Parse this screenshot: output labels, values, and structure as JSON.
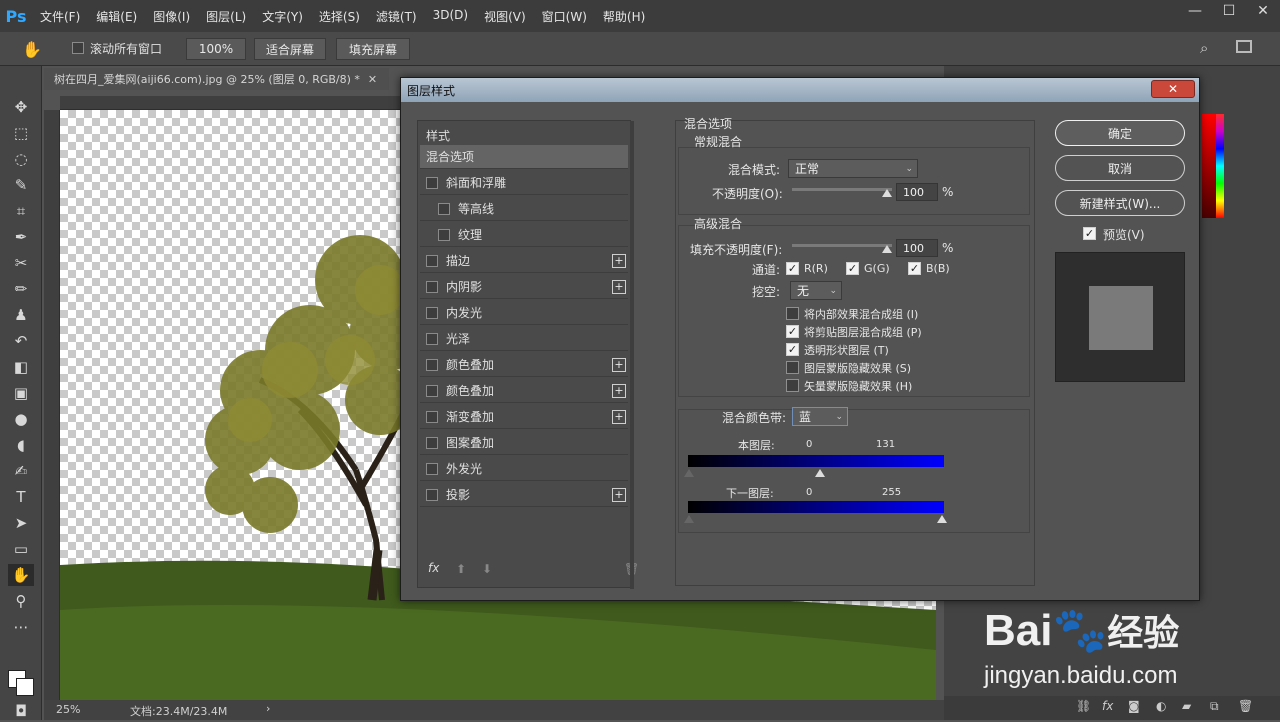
{
  "menubar": {
    "logo": "Ps",
    "items": [
      "文件(F)",
      "编辑(E)",
      "图像(I)",
      "图层(L)",
      "文字(Y)",
      "选择(S)",
      "滤镜(T)",
      "3D(D)",
      "视图(V)",
      "窗口(W)",
      "帮助(H)"
    ]
  },
  "options": {
    "scroll_all_label": "滚动所有窗口",
    "zoom": "100%",
    "fit_screen": "适合屏幕",
    "fill_screen": "填充屏幕"
  },
  "document": {
    "tab_title": "树在四月_爱集网(aiji66.com).jpg @ 25% (图层 0, RGB/8) *",
    "zoom_status": "25%",
    "doc_size": "文档:23.4M/23.4M"
  },
  "dialog": {
    "title": "图层样式",
    "style_list_header": "样式",
    "styles": [
      {
        "label": "混合选项",
        "checkbox": false,
        "plus": false,
        "selected": true,
        "indent": false
      },
      {
        "label": "斜面和浮雕",
        "checkbox": true,
        "plus": false,
        "selected": false,
        "indent": false
      },
      {
        "label": "等高线",
        "checkbox": true,
        "plus": false,
        "selected": false,
        "indent": true
      },
      {
        "label": "纹理",
        "checkbox": true,
        "plus": false,
        "selected": false,
        "indent": true
      },
      {
        "label": "描边",
        "checkbox": true,
        "plus": true,
        "selected": false,
        "indent": false
      },
      {
        "label": "内阴影",
        "checkbox": true,
        "plus": true,
        "selected": false,
        "indent": false
      },
      {
        "label": "内发光",
        "checkbox": true,
        "plus": false,
        "selected": false,
        "indent": false
      },
      {
        "label": "光泽",
        "checkbox": true,
        "plus": false,
        "selected": false,
        "indent": false
      },
      {
        "label": "颜色叠加",
        "checkbox": true,
        "plus": true,
        "selected": false,
        "indent": false
      },
      {
        "label": "颜色叠加",
        "checkbox": true,
        "plus": true,
        "selected": false,
        "indent": false
      },
      {
        "label": "渐变叠加",
        "checkbox": true,
        "plus": true,
        "selected": false,
        "indent": false
      },
      {
        "label": "图案叠加",
        "checkbox": true,
        "plus": false,
        "selected": false,
        "indent": false
      },
      {
        "label": "外发光",
        "checkbox": true,
        "plus": false,
        "selected": false,
        "indent": false
      },
      {
        "label": "投影",
        "checkbox": true,
        "plus": true,
        "selected": false,
        "indent": false
      }
    ],
    "fx_label": "fx",
    "blend": {
      "section_title": "混合选项",
      "general_title": "常规混合",
      "mode_label": "混合模式:",
      "mode_value": "正常",
      "opacity_label": "不透明度(O):",
      "opacity_value": "100",
      "percent": "%",
      "advanced_title": "高级混合",
      "fill_label": "填充不透明度(F):",
      "fill_value": "100",
      "channels_label": "通道:",
      "channel_r": "R(R)",
      "channel_g": "G(G)",
      "channel_b": "B(B)",
      "knockout_label": "挖空:",
      "knockout_value": "无",
      "options": [
        {
          "label": "将内部效果混合成组 (I)",
          "checked": false
        },
        {
          "label": "将剪贴图层混合成组 (P)",
          "checked": true
        },
        {
          "label": "透明形状图层 (T)",
          "checked": true
        },
        {
          "label": "图层蒙版隐藏效果 (S)",
          "checked": false
        },
        {
          "label": "矢量蒙版隐藏效果 (H)",
          "checked": false
        }
      ],
      "blend_if_label": "混合颜色带:",
      "blend_if_value": "蓝",
      "this_layer_label": "本图层:",
      "this_layer_low": "0",
      "this_layer_high": "131",
      "this_layer_high_fraction": 0.514,
      "underlying_label": "下一图层:",
      "underlying_low": "0",
      "underlying_high": "255"
    },
    "buttons": {
      "ok": "确定",
      "cancel": "取消",
      "new_style": "新建样式(W)...",
      "preview_label": "预览(V)"
    }
  },
  "watermark": {
    "brand": "Bai",
    "brand_suffix": "经验",
    "url": "jingyan.baidu.com"
  }
}
